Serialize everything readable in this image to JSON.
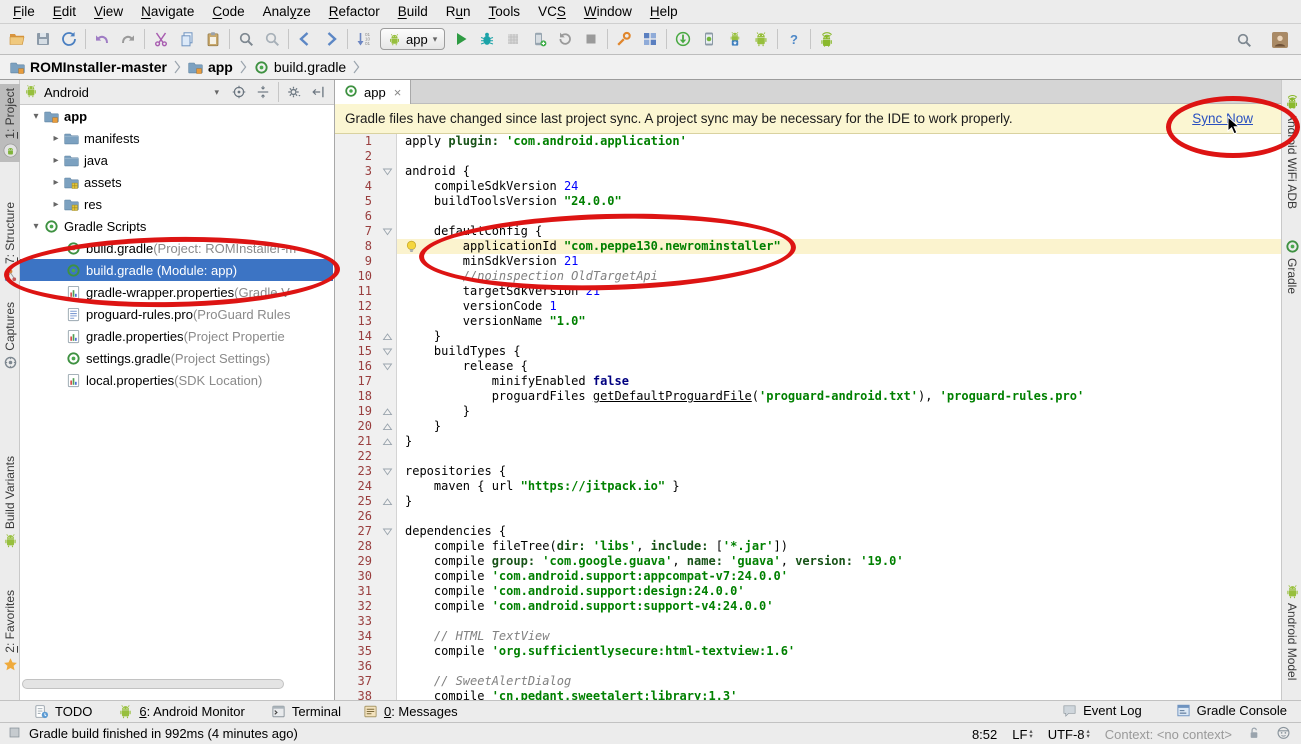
{
  "annotation_color": "#dd1413",
  "menubar": {
    "items": [
      {
        "pre": "",
        "mn": "F",
        "post": "ile"
      },
      {
        "pre": "",
        "mn": "E",
        "post": "dit"
      },
      {
        "pre": "",
        "mn": "V",
        "post": "iew"
      },
      {
        "pre": "",
        "mn": "N",
        "post": "avigate"
      },
      {
        "pre": "",
        "mn": "C",
        "post": "ode"
      },
      {
        "pre": "Anal",
        "mn": "y",
        "post": "ze"
      },
      {
        "pre": "",
        "mn": "R",
        "post": "efactor"
      },
      {
        "pre": "",
        "mn": "B",
        "post": "uild"
      },
      {
        "pre": "R",
        "mn": "u",
        "post": "n"
      },
      {
        "pre": "",
        "mn": "T",
        "post": "ools"
      },
      {
        "pre": "VC",
        "mn": "S",
        "post": ""
      },
      {
        "pre": "",
        "mn": "W",
        "post": "indow"
      },
      {
        "pre": "",
        "mn": "H",
        "post": "elp"
      }
    ]
  },
  "toolbar": {
    "run_config": "app",
    "groups": [
      [
        "folder-open",
        "save",
        "sync"
      ],
      [
        "undo",
        "redo"
      ],
      [
        "cut",
        "copy",
        "paste"
      ],
      [
        "find",
        "replace"
      ],
      [
        "back",
        "forward"
      ],
      [
        "sort",
        "__combo__",
        "run",
        "debug",
        "coverage",
        "attach",
        "rerun",
        "stop"
      ],
      [
        "wrench",
        "structure"
      ],
      [
        "gradle-sync",
        "avd",
        "sdk",
        "monitor"
      ],
      [
        "help"
      ],
      [
        "wifi-adb"
      ]
    ],
    "right_icons": [
      "search",
      "avatar"
    ]
  },
  "breadcrumb": {
    "items": [
      {
        "icon": "folder-app",
        "label": "ROMInstaller-master",
        "bold": true
      },
      {
        "icon": "folder-app",
        "label": "app",
        "bold": true
      },
      {
        "icon": "gradle",
        "label": "build.gradle",
        "bold": false
      }
    ]
  },
  "left_stripe": [
    {
      "icon": "android-circle",
      "mn": "1",
      "rest": ": Project",
      "active": true
    },
    {
      "icon": "structure-colored",
      "mn": "7",
      "rest": ": Structure",
      "active": false
    },
    {
      "icon": "captures",
      "mn": "",
      "rest": "Captures",
      "active": false
    },
    {
      "icon": "android",
      "mn": "",
      "rest": "Build Variants",
      "active": false
    },
    {
      "icon": "star",
      "mn": "2",
      "rest": ": Favorites",
      "active": false
    }
  ],
  "right_stripe": [
    {
      "icon": "wifi-adb",
      "label": "Android WiFi ADB"
    },
    {
      "icon": "gradle",
      "label": "Gradle"
    },
    {
      "icon": "android",
      "label": "Android Model"
    }
  ],
  "project_panel": {
    "mode": "Android",
    "header_icons": [
      "target",
      "collapse",
      "gear",
      "hide"
    ],
    "tree": [
      {
        "exp": "open",
        "pad": 8,
        "icon": "folder-app",
        "label": "app",
        "desc": "",
        "bold": true,
        "selected": false
      },
      {
        "exp": "closed",
        "pad": 28,
        "icon": "folder",
        "label": "manifests",
        "desc": "",
        "bold": false,
        "selected": false
      },
      {
        "exp": "closed",
        "pad": 28,
        "icon": "folder",
        "label": "java",
        "desc": "",
        "bold": false,
        "selected": false
      },
      {
        "exp": "closed",
        "pad": 28,
        "icon": "folder-res",
        "label": "assets",
        "desc": "",
        "bold": false,
        "selected": false
      },
      {
        "exp": "closed",
        "pad": 28,
        "icon": "folder-res",
        "label": "res",
        "desc": "",
        "bold": false,
        "selected": false
      },
      {
        "exp": "open",
        "pad": 8,
        "icon": "gradle",
        "label": "Gradle Scripts",
        "desc": "",
        "bold": false,
        "selected": false
      },
      {
        "exp": null,
        "pad": 46,
        "icon": "gradle",
        "label": "build.gradle",
        "desc": " (Project: ROMInstaller-m",
        "bold": false,
        "selected": false
      },
      {
        "exp": null,
        "pad": 46,
        "icon": "gradle",
        "label": "build.gradle (Module: app)",
        "desc": "",
        "bold": false,
        "selected": true
      },
      {
        "exp": null,
        "pad": 46,
        "icon": "props",
        "label": "gradle-wrapper.properties",
        "desc": " (Gradle V",
        "bold": false,
        "selected": false
      },
      {
        "exp": null,
        "pad": 46,
        "icon": "textfile",
        "label": "proguard-rules.pro",
        "desc": " (ProGuard Rules",
        "bold": false,
        "selected": false
      },
      {
        "exp": null,
        "pad": 46,
        "icon": "props",
        "label": "gradle.properties",
        "desc": " (Project Propertie",
        "bold": false,
        "selected": false
      },
      {
        "exp": null,
        "pad": 46,
        "icon": "gradle",
        "label": "settings.gradle",
        "desc": " (Project Settings)",
        "bold": false,
        "selected": false
      },
      {
        "exp": null,
        "pad": 46,
        "icon": "props",
        "label": "local.properties",
        "desc": " (SDK Location)",
        "bold": false,
        "selected": false
      }
    ]
  },
  "editor": {
    "tab": {
      "label": "app",
      "icon": "gradle",
      "close": "×"
    },
    "banner": {
      "text": "Gradle files have changed since last project sync. A project sync may be necessary for the IDE to work properly.",
      "action_label": "Sync Now"
    },
    "code": {
      "highlighted_line": 8,
      "folds": {
        "3": "open",
        "7": "open",
        "14": "close",
        "15": "open",
        "16": "open",
        "19": "close",
        "20": "close",
        "21": "close",
        "23": "open",
        "25": "close",
        "27": "open"
      },
      "lines": [
        [
          [
            "d",
            "apply "
          ],
          [
            "key",
            "plugin:"
          ],
          [
            "d",
            " "
          ],
          [
            "str",
            "'com.android.application'"
          ]
        ],
        [],
        [
          [
            "d",
            "android {"
          ]
        ],
        [
          [
            "d",
            "    compileSdkVersion "
          ],
          [
            "num",
            "24"
          ]
        ],
        [
          [
            "d",
            "    buildToolsVersion "
          ],
          [
            "str",
            "\"24.0.0\""
          ]
        ],
        [],
        [
          [
            "d",
            "    defaultConfig {"
          ]
        ],
        [
          [
            "d",
            "        applicationId "
          ],
          [
            "str",
            "\"com.peppe130.newrominstaller\""
          ]
        ],
        [
          [
            "d",
            "        minSdkVersion "
          ],
          [
            "num",
            "21"
          ]
        ],
        [
          [
            "cmt",
            "        //noinspection OldTargetApi"
          ]
        ],
        [
          [
            "d",
            "        targetSdkVersion "
          ],
          [
            "num",
            "21"
          ]
        ],
        [
          [
            "d",
            "        versionCode "
          ],
          [
            "num",
            "1"
          ]
        ],
        [
          [
            "d",
            "        versionName "
          ],
          [
            "str",
            "\"1.0\""
          ]
        ],
        [
          [
            "d",
            "    }"
          ]
        ],
        [
          [
            "d",
            "    buildTypes {"
          ]
        ],
        [
          [
            "d",
            "        release {"
          ]
        ],
        [
          [
            "d",
            "            minifyEnabled "
          ],
          [
            "kw",
            "false"
          ]
        ],
        [
          [
            "d",
            "            proguardFiles "
          ],
          [
            "ul",
            "getDefaultProguardFile"
          ],
          [
            "d",
            "("
          ],
          [
            "str",
            "'proguard-android.txt'"
          ],
          [
            "d",
            "), "
          ],
          [
            "str",
            "'proguard-rules.pro'"
          ]
        ],
        [
          [
            "d",
            "        }"
          ]
        ],
        [
          [
            "d",
            "    }"
          ]
        ],
        [
          [
            "d",
            "}"
          ]
        ],
        [],
        [
          [
            "d",
            "repositories {"
          ]
        ],
        [
          [
            "d",
            "    maven { url "
          ],
          [
            "str",
            "\"https://jitpack.io\""
          ],
          [
            "d",
            " }"
          ]
        ],
        [
          [
            "d",
            "}"
          ]
        ],
        [],
        [
          [
            "d",
            "dependencies {"
          ]
        ],
        [
          [
            "d",
            "    compile fileTree("
          ],
          [
            "key",
            "dir:"
          ],
          [
            "d",
            " "
          ],
          [
            "str",
            "'libs'"
          ],
          [
            "d",
            ", "
          ],
          [
            "key",
            "include:"
          ],
          [
            "d",
            " ["
          ],
          [
            "str",
            "'*.jar'"
          ],
          [
            "d",
            "])"
          ]
        ],
        [
          [
            "d",
            "    compile "
          ],
          [
            "key",
            "group:"
          ],
          [
            "d",
            " "
          ],
          [
            "str",
            "'com.google.guava'"
          ],
          [
            "d",
            ", "
          ],
          [
            "key",
            "name:"
          ],
          [
            "d",
            " "
          ],
          [
            "str",
            "'guava'"
          ],
          [
            "d",
            ", "
          ],
          [
            "key",
            "version:"
          ],
          [
            "d",
            " "
          ],
          [
            "str",
            "'19.0'"
          ]
        ],
        [
          [
            "d",
            "    compile "
          ],
          [
            "str",
            "'com.android.support:appcompat-v7:24.0.0'"
          ]
        ],
        [
          [
            "d",
            "    compile "
          ],
          [
            "str",
            "'com.android.support:design:24.0.0'"
          ]
        ],
        [
          [
            "d",
            "    compile "
          ],
          [
            "str",
            "'com.android.support:support-v4:24.0.0'"
          ]
        ],
        [],
        [
          [
            "cmt",
            "    // HTML TextView"
          ]
        ],
        [
          [
            "d",
            "    compile "
          ],
          [
            "str",
            "'org.sufficientlysecure:html-textview:1.6'"
          ]
        ],
        [],
        [
          [
            "cmt",
            "    // SweetAlertDialog"
          ]
        ],
        [
          [
            "d",
            "    compile "
          ],
          [
            "str",
            "'cn.pedant.sweetalert:library:1.3'"
          ]
        ]
      ]
    }
  },
  "toolwindow_bar": {
    "left": [
      {
        "icon": "todo",
        "mn": "",
        "label": "TODO"
      },
      {
        "icon": "android",
        "mn": "6",
        "label": ": Android Monitor"
      },
      {
        "icon": "terminal",
        "mn": "",
        "label": "Terminal"
      },
      {
        "icon": "messages",
        "mn": "0",
        "label": ": Messages"
      }
    ],
    "right": [
      {
        "icon": "eventlog",
        "label": "Event Log"
      },
      {
        "icon": "console",
        "label": "Gradle Console"
      }
    ]
  },
  "statusbar": {
    "message": "Gradle build finished in 992ms (4 minutes ago)",
    "position": "8:52",
    "line_ending": "LF",
    "encoding": "UTF-8",
    "context": "Context: <no context>"
  }
}
